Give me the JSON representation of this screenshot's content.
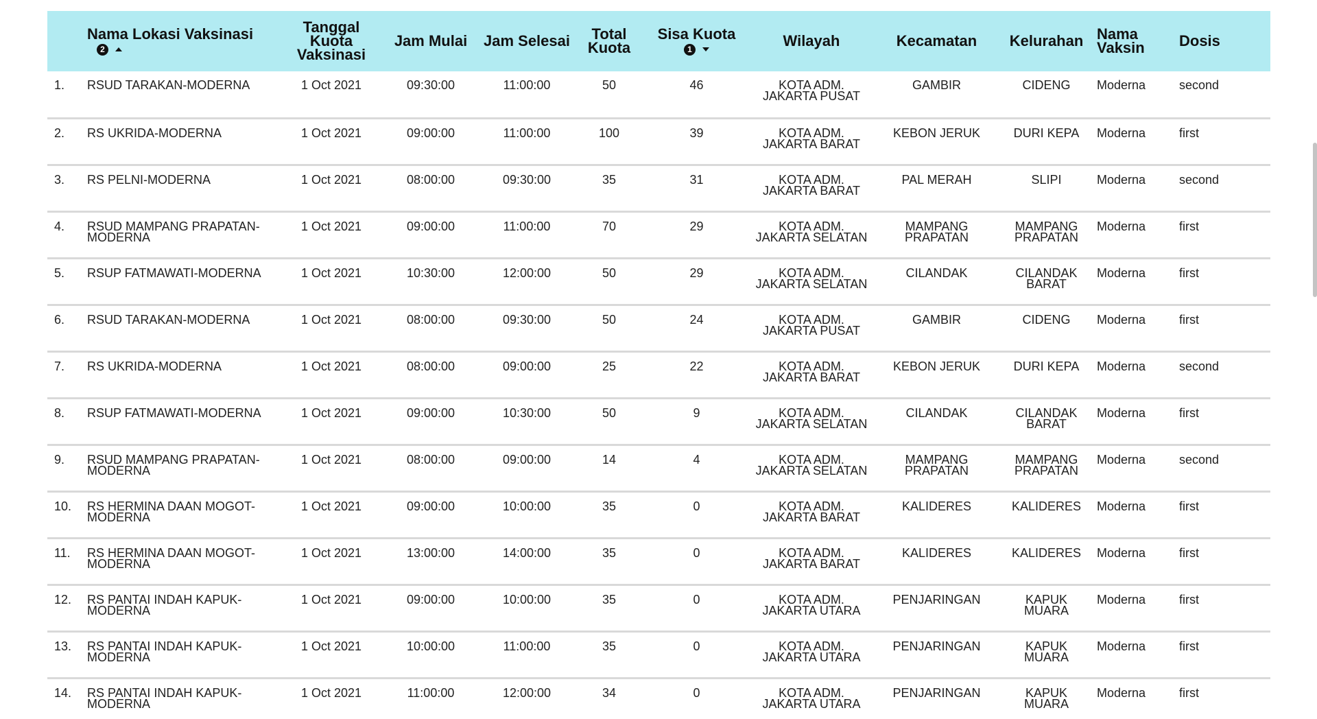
{
  "columns": [
    {
      "label": "Nama Lokasi Vaksinasi",
      "sort_order": "2",
      "sort_dir": "asc"
    },
    {
      "label": "Tanggal Kuota Vaksinasi"
    },
    {
      "label": "Jam Mulai"
    },
    {
      "label": "Jam Selesai"
    },
    {
      "label": "Total Kuota"
    },
    {
      "label": "Sisa Kuota",
      "sort_order": "1",
      "sort_dir": "desc"
    },
    {
      "label": "Wilayah"
    },
    {
      "label": "Kecamatan"
    },
    {
      "label": "Kelurahan"
    },
    {
      "label": "Nama Vaksin"
    },
    {
      "label": "Dosis"
    }
  ],
  "rows": [
    {
      "no": "1.",
      "lokasi": "RSUD TARAKAN-MODERNA",
      "tanggal": "1 Oct 2021",
      "mulai": "09:30:00",
      "selesai": "11:00:00",
      "total": "50",
      "sisa": "46",
      "wilayah": "KOTA ADM. JAKARTA PUSAT",
      "kecamatan": "GAMBIR",
      "kelurahan": "CIDENG",
      "vaksin": "Moderna",
      "dosis": "second"
    },
    {
      "no": "2.",
      "lokasi": "RS UKRIDA-MODERNA",
      "tanggal": "1 Oct 2021",
      "mulai": "09:00:00",
      "selesai": "11:00:00",
      "total": "100",
      "sisa": "39",
      "wilayah": "KOTA ADM. JAKARTA BARAT",
      "kecamatan": "KEBON JERUK",
      "kelurahan": "DURI KEPA",
      "vaksin": "Moderna",
      "dosis": "first"
    },
    {
      "no": "3.",
      "lokasi": "RS PELNI-MODERNA",
      "tanggal": "1 Oct 2021",
      "mulai": "08:00:00",
      "selesai": "09:30:00",
      "total": "35",
      "sisa": "31",
      "wilayah": "KOTA ADM. JAKARTA BARAT",
      "kecamatan": "PAL MERAH",
      "kelurahan": "SLIPI",
      "vaksin": "Moderna",
      "dosis": "second"
    },
    {
      "no": "4.",
      "lokasi": "RSUD MAMPANG PRAPATAN-MODERNA",
      "tanggal": "1 Oct 2021",
      "mulai": "09:00:00",
      "selesai": "11:00:00",
      "total": "70",
      "sisa": "29",
      "wilayah": "KOTA ADM. JAKARTA SELATAN",
      "kecamatan": "MAMPANG PRAPATAN",
      "kelurahan": "MAMPANG PRAPATAN",
      "vaksin": "Moderna",
      "dosis": "first"
    },
    {
      "no": "5.",
      "lokasi": "RSUP FATMAWATI-MODERNA",
      "tanggal": "1 Oct 2021",
      "mulai": "10:30:00",
      "selesai": "12:00:00",
      "total": "50",
      "sisa": "29",
      "wilayah": "KOTA ADM. JAKARTA SELATAN",
      "kecamatan": "CILANDAK",
      "kelurahan": "CILANDAK BARAT",
      "vaksin": "Moderna",
      "dosis": "first"
    },
    {
      "no": "6.",
      "lokasi": "RSUD TARAKAN-MODERNA",
      "tanggal": "1 Oct 2021",
      "mulai": "08:00:00",
      "selesai": "09:30:00",
      "total": "50",
      "sisa": "24",
      "wilayah": "KOTA ADM. JAKARTA PUSAT",
      "kecamatan": "GAMBIR",
      "kelurahan": "CIDENG",
      "vaksin": "Moderna",
      "dosis": "first"
    },
    {
      "no": "7.",
      "lokasi": "RS UKRIDA-MODERNA",
      "tanggal": "1 Oct 2021",
      "mulai": "08:00:00",
      "selesai": "09:00:00",
      "total": "25",
      "sisa": "22",
      "wilayah": "KOTA ADM. JAKARTA BARAT",
      "kecamatan": "KEBON JERUK",
      "kelurahan": "DURI KEPA",
      "vaksin": "Moderna",
      "dosis": "second"
    },
    {
      "no": "8.",
      "lokasi": "RSUP FATMAWATI-MODERNA",
      "tanggal": "1 Oct 2021",
      "mulai": "09:00:00",
      "selesai": "10:30:00",
      "total": "50",
      "sisa": "9",
      "wilayah": "KOTA ADM. JAKARTA SELATAN",
      "kecamatan": "CILANDAK",
      "kelurahan": "CILANDAK BARAT",
      "vaksin": "Moderna",
      "dosis": "first"
    },
    {
      "no": "9.",
      "lokasi": "RSUD MAMPANG PRAPATAN-MODERNA",
      "tanggal": "1 Oct 2021",
      "mulai": "08:00:00",
      "selesai": "09:00:00",
      "total": "14",
      "sisa": "4",
      "wilayah": "KOTA ADM. JAKARTA SELATAN",
      "kecamatan": "MAMPANG PRAPATAN",
      "kelurahan": "MAMPANG PRAPATAN",
      "vaksin": "Moderna",
      "dosis": "second"
    },
    {
      "no": "10.",
      "lokasi": "RS HERMINA DAAN MOGOT-MODERNA",
      "tanggal": "1 Oct 2021",
      "mulai": "09:00:00",
      "selesai": "10:00:00",
      "total": "35",
      "sisa": "0",
      "wilayah": "KOTA ADM. JAKARTA BARAT",
      "kecamatan": "KALIDERES",
      "kelurahan": "KALIDERES",
      "vaksin": "Moderna",
      "dosis": "first"
    },
    {
      "no": "11.",
      "lokasi": "RS HERMINA DAAN MOGOT-MODERNA",
      "tanggal": "1 Oct 2021",
      "mulai": "13:00:00",
      "selesai": "14:00:00",
      "total": "35",
      "sisa": "0",
      "wilayah": "KOTA ADM. JAKARTA BARAT",
      "kecamatan": "KALIDERES",
      "kelurahan": "KALIDERES",
      "vaksin": "Moderna",
      "dosis": "first"
    },
    {
      "no": "12.",
      "lokasi": "RS PANTAI INDAH KAPUK-MODERNA",
      "tanggal": "1 Oct 2021",
      "mulai": "09:00:00",
      "selesai": "10:00:00",
      "total": "35",
      "sisa": "0",
      "wilayah": "KOTA ADM. JAKARTA UTARA",
      "kecamatan": "PENJARINGAN",
      "kelurahan": "KAPUK MUARA",
      "vaksin": "Moderna",
      "dosis": "first"
    },
    {
      "no": "13.",
      "lokasi": "RS PANTAI INDAH KAPUK-MODERNA",
      "tanggal": "1 Oct 2021",
      "mulai": "10:00:00",
      "selesai": "11:00:00",
      "total": "35",
      "sisa": "0",
      "wilayah": "KOTA ADM. JAKARTA UTARA",
      "kecamatan": "PENJARINGAN",
      "kelurahan": "KAPUK MUARA",
      "vaksin": "Moderna",
      "dosis": "first"
    },
    {
      "no": "14.",
      "lokasi": "RS PANTAI INDAH KAPUK-MODERNA",
      "tanggal": "1 Oct 2021",
      "mulai": "11:00:00",
      "selesai": "12:00:00",
      "total": "34",
      "sisa": "0",
      "wilayah": "KOTA ADM. JAKARTA UTARA",
      "kecamatan": "PENJARINGAN",
      "kelurahan": "KAPUK MUARA",
      "vaksin": "Moderna",
      "dosis": "first"
    }
  ]
}
